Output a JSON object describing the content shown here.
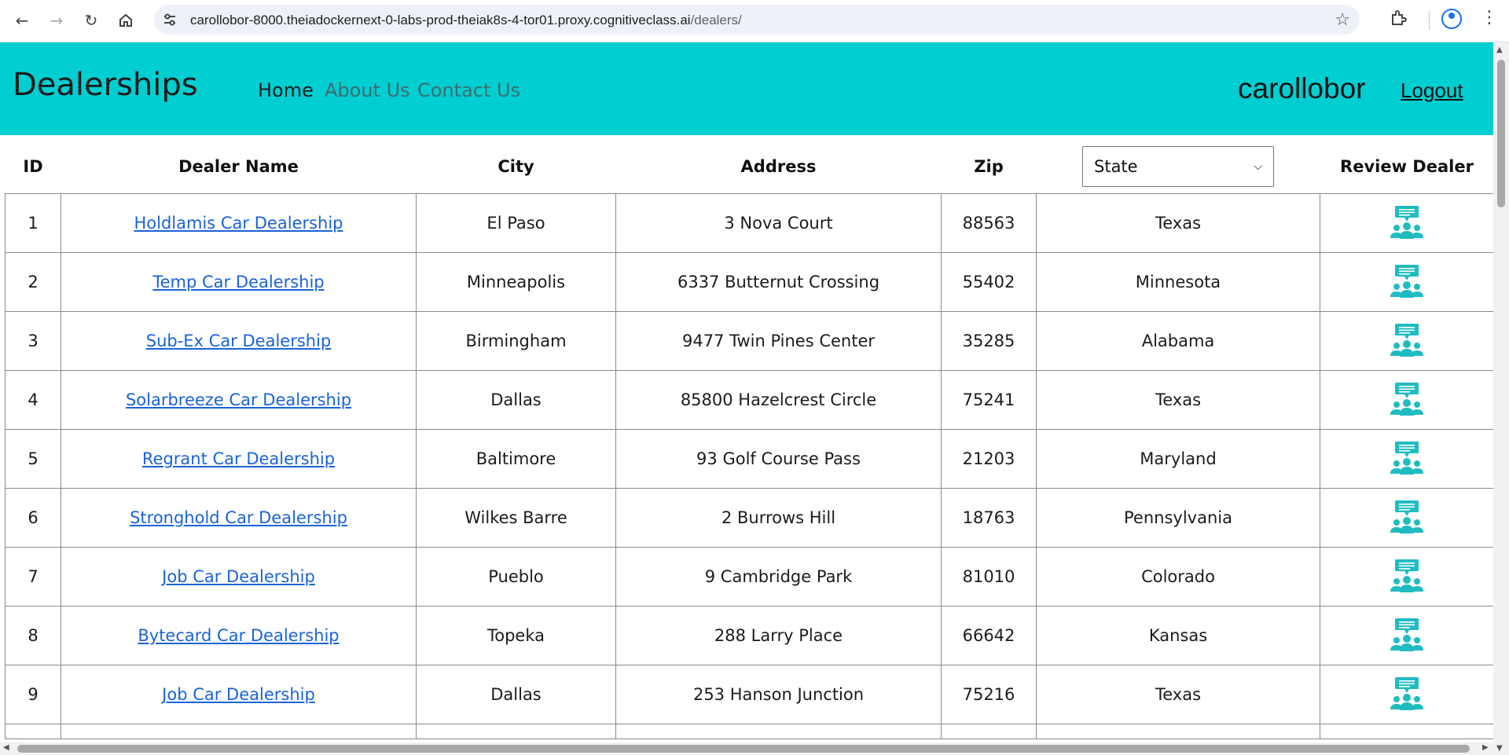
{
  "browser": {
    "url_host": "carollobor-8000.theiadockernext-0-labs-prod-theiak8s-4-tor01.proxy.cognitiveclass.ai",
    "url_path": "/dealers/"
  },
  "header": {
    "brand": "Dealerships",
    "nav": {
      "home": "Home",
      "about": "About Us",
      "contact": "Contact Us"
    },
    "username": "carollobor",
    "logout": "Logout",
    "background_color": "#00ced1"
  },
  "table": {
    "columns": {
      "id": "ID",
      "dealer_name": "Dealer Name",
      "city": "City",
      "address": "Address",
      "zip": "Zip",
      "review": "Review Dealer"
    },
    "state_select": {
      "selected": "State"
    },
    "review_icon": "review-people-icon",
    "rows": [
      {
        "id": "1",
        "name": "Holdlamis Car Dealership",
        "city": "El Paso",
        "address": "3 Nova Court",
        "zip": "88563",
        "state": "Texas"
      },
      {
        "id": "2",
        "name": "Temp Car Dealership",
        "city": "Minneapolis",
        "address": "6337 Butternut Crossing",
        "zip": "55402",
        "state": "Minnesota"
      },
      {
        "id": "3",
        "name": "Sub-Ex Car Dealership",
        "city": "Birmingham",
        "address": "9477 Twin Pines Center",
        "zip": "35285",
        "state": "Alabama"
      },
      {
        "id": "4",
        "name": "Solarbreeze Car Dealership",
        "city": "Dallas",
        "address": "85800 Hazelcrest Circle",
        "zip": "75241",
        "state": "Texas"
      },
      {
        "id": "5",
        "name": "Regrant Car Dealership",
        "city": "Baltimore",
        "address": "93 Golf Course Pass",
        "zip": "21203",
        "state": "Maryland"
      },
      {
        "id": "6",
        "name": "Stronghold Car Dealership",
        "city": "Wilkes Barre",
        "address": "2 Burrows Hill",
        "zip": "18763",
        "state": "Pennsylvania"
      },
      {
        "id": "7",
        "name": "Job Car Dealership",
        "city": "Pueblo",
        "address": "9 Cambridge Park",
        "zip": "81010",
        "state": "Colorado"
      },
      {
        "id": "8",
        "name": "Bytecard Car Dealership",
        "city": "Topeka",
        "address": "288 Larry Place",
        "zip": "66642",
        "state": "Kansas"
      },
      {
        "id": "9",
        "name": "Job Car Dealership",
        "city": "Dallas",
        "address": "253 Hanson Junction",
        "zip": "75216",
        "state": "Texas"
      }
    ],
    "accent_color": "#1fbcc1",
    "link_color": "#1a63d8"
  }
}
